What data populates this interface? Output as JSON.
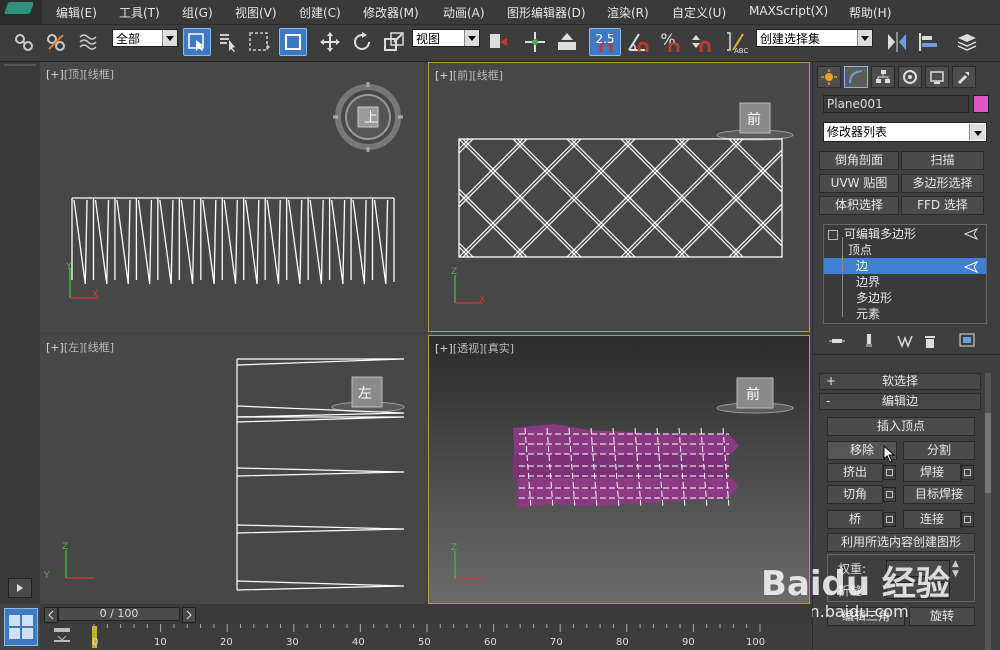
{
  "menu": {
    "items": [
      "编辑(E)",
      "工具(T)",
      "组(G)",
      "视图(V)",
      "创建(C)",
      "修改器(M)",
      "动画(A)",
      "图形编辑器(D)",
      "渲染(R)",
      "自定义(U)",
      "MAXScript(X)",
      "帮助(H)"
    ]
  },
  "toolbar": {
    "selection_filter": "全部",
    "ref_coord": "视图",
    "snap_angle": "2.5",
    "named_selection": "创建选择集"
  },
  "viewports": {
    "top": {
      "label_a": "[+]",
      "label_b": "[顶]",
      "label_c": "[线框]",
      "cube_text": "上"
    },
    "front": {
      "label_a": "[+]",
      "label_b": "[前]",
      "label_c": "[线框]",
      "cube_text": "前"
    },
    "left": {
      "label_a": "[+]",
      "label_b": "[左]",
      "label_c": "[线框]",
      "cube_text": "左"
    },
    "perspective": {
      "label_a": "[+]",
      "label_b": "[透视]",
      "label_c": "[真实]",
      "cube_text": "前"
    }
  },
  "axes": {
    "x": "X",
    "y": "Y",
    "z": "Z"
  },
  "panel": {
    "object_name": "Plane001",
    "object_color": "#e055c8",
    "modifier_list": "修改器列表",
    "mod_buttons": [
      "倒角剖面",
      "扫描",
      "UVW 贴图",
      "多边形选择",
      "体积选择",
      "FFD 选择"
    ],
    "stack": {
      "root": "可编辑多边形",
      "items": [
        "顶点",
        "边",
        "边界",
        "多边形",
        "元素"
      ],
      "selected_index": 1
    },
    "rollouts": {
      "soft_select": "软选择",
      "edit_edges": "编辑边",
      "soft_sign": "+",
      "edit_sign": "-"
    },
    "edit_edge_buttons": {
      "insert_vertex": "插入顶点",
      "remove": "移除",
      "split": "分割",
      "extrude": "挤出",
      "weld": "焊接",
      "chamfer": "切角",
      "target_weld": "目标焊接",
      "bridge": "桥",
      "connect": "连接",
      "create_shape": "利用所选内容创建图形",
      "weight_label": "权重:",
      "crease_label": "折缝:",
      "edit_tri": "编辑三角",
      "turn": "旋转"
    }
  },
  "timeline": {
    "frame_display": "0 / 100",
    "ticks": [
      "0",
      "10",
      "20",
      "30",
      "40",
      "50",
      "60",
      "70",
      "80",
      "90",
      "100"
    ]
  },
  "watermark": {
    "brand": "Baidu 经验",
    "url": "jingyan.baidu.com"
  },
  "colors": {
    "accent": "#3e79c4",
    "selection_highlight": "#3f7fd6",
    "active_viewport": "#b99a36",
    "mesh_pink": "#8a3a82"
  }
}
